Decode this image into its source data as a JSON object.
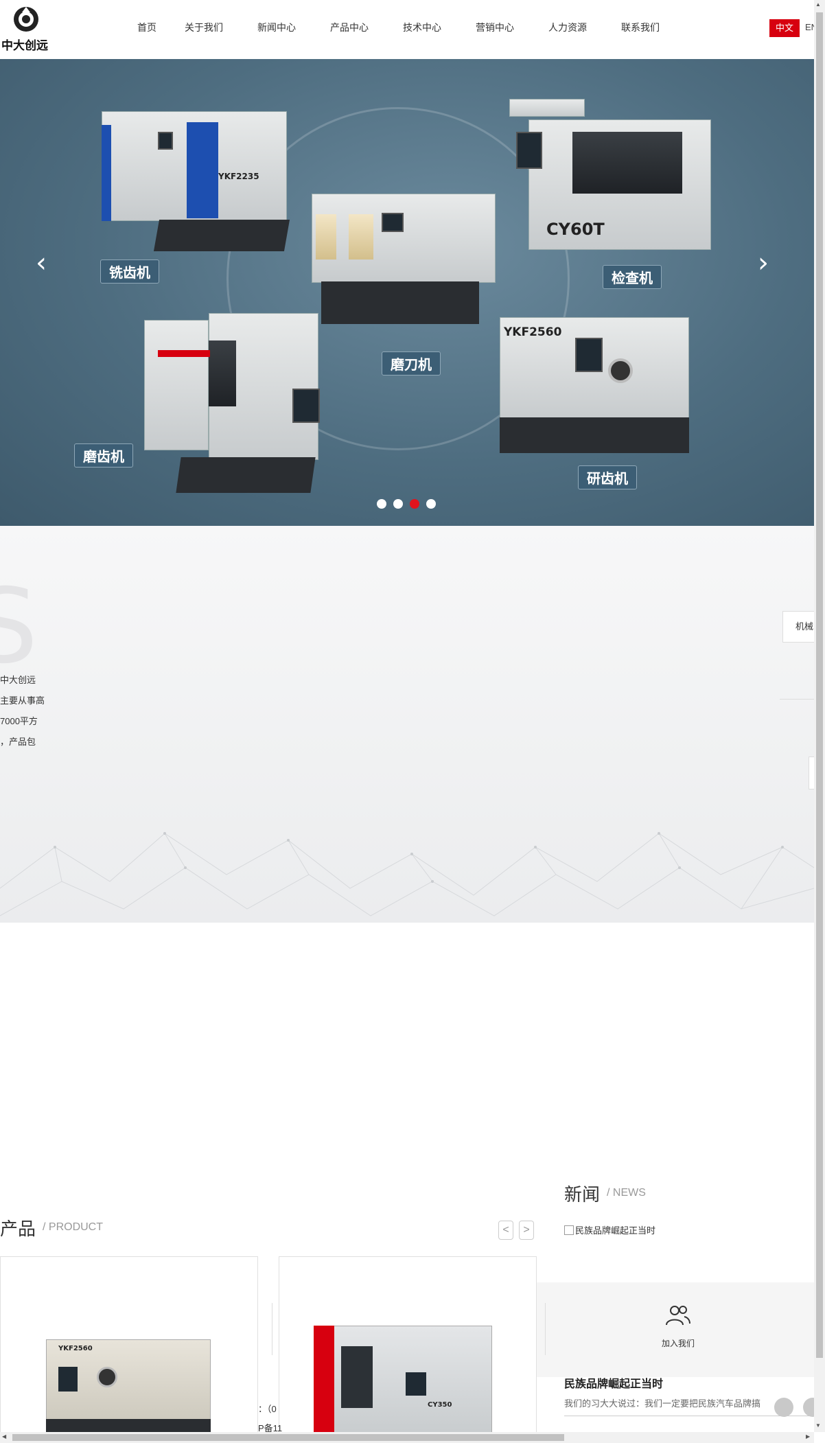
{
  "header": {
    "logo_text": "中大创远",
    "nav": [
      "首页",
      "关于我们",
      "新闻中心",
      "产品中心",
      "技术中心",
      "营销中心",
      "人力资源",
      "联系我们"
    ],
    "lang_cn": "中文",
    "lang_en": "EN"
  },
  "banner": {
    "labels": [
      "铣齿机",
      "磨刀机",
      "检查机",
      "磨齿机",
      "研齿机"
    ],
    "model_codes": [
      "YKF2235",
      "CY60T",
      "YKF2560",
      "CY350"
    ],
    "dots_total": 4,
    "dots_active": 3
  },
  "about": {
    "big_letter": "S",
    "lines": [
      "中大创远",
      "主要从事高",
      "7000平方",
      "，产品包"
    ],
    "tab_label": "机械"
  },
  "products": {
    "title": "产品",
    "subtitle": "/ PRODUCT",
    "prev": "<",
    "next": ">",
    "card_codes": [
      "YKF2560",
      "CY350"
    ]
  },
  "news": {
    "title": "新闻",
    "subtitle": "/ NEWS",
    "item": "民族品牌崛起正当时",
    "join_label": "加入我们",
    "headline": "民族品牌崛起正当时",
    "excerpt": "我们的习大大说过：我们一定要把民族汽车品牌搞"
  },
  "footer": {
    "frag1": "：（0",
    "frag2": "P备11"
  },
  "colors": {
    "brand_red": "#d7000f",
    "banner_blue": "#4e6d80",
    "active_dot": "#e1131d"
  }
}
